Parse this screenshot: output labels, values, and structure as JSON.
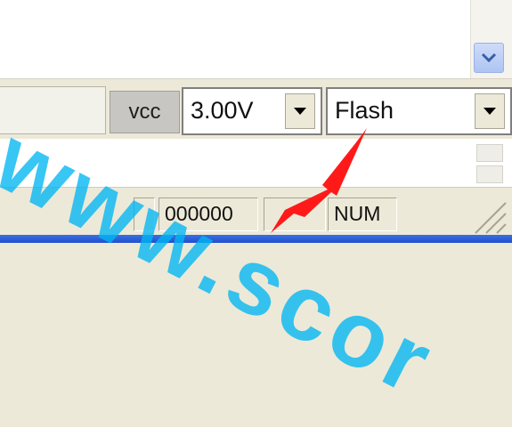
{
  "toolbar": {
    "vcc_label": "vcc",
    "voltage_value": "3.00V",
    "mode_value": "Flash"
  },
  "status_bar": {
    "counter": "000000",
    "num_indicator": "NUM"
  },
  "watermark": "www.scor",
  "icons": [
    "chevron-down-icon",
    "dropdown-arrow-icon",
    "resize-grip-icon",
    "red-arrow-annotation"
  ],
  "colors": {
    "watermark": "#00b6f2",
    "arrow": "#ff1a1a",
    "taskbar": "#2a5de0"
  }
}
